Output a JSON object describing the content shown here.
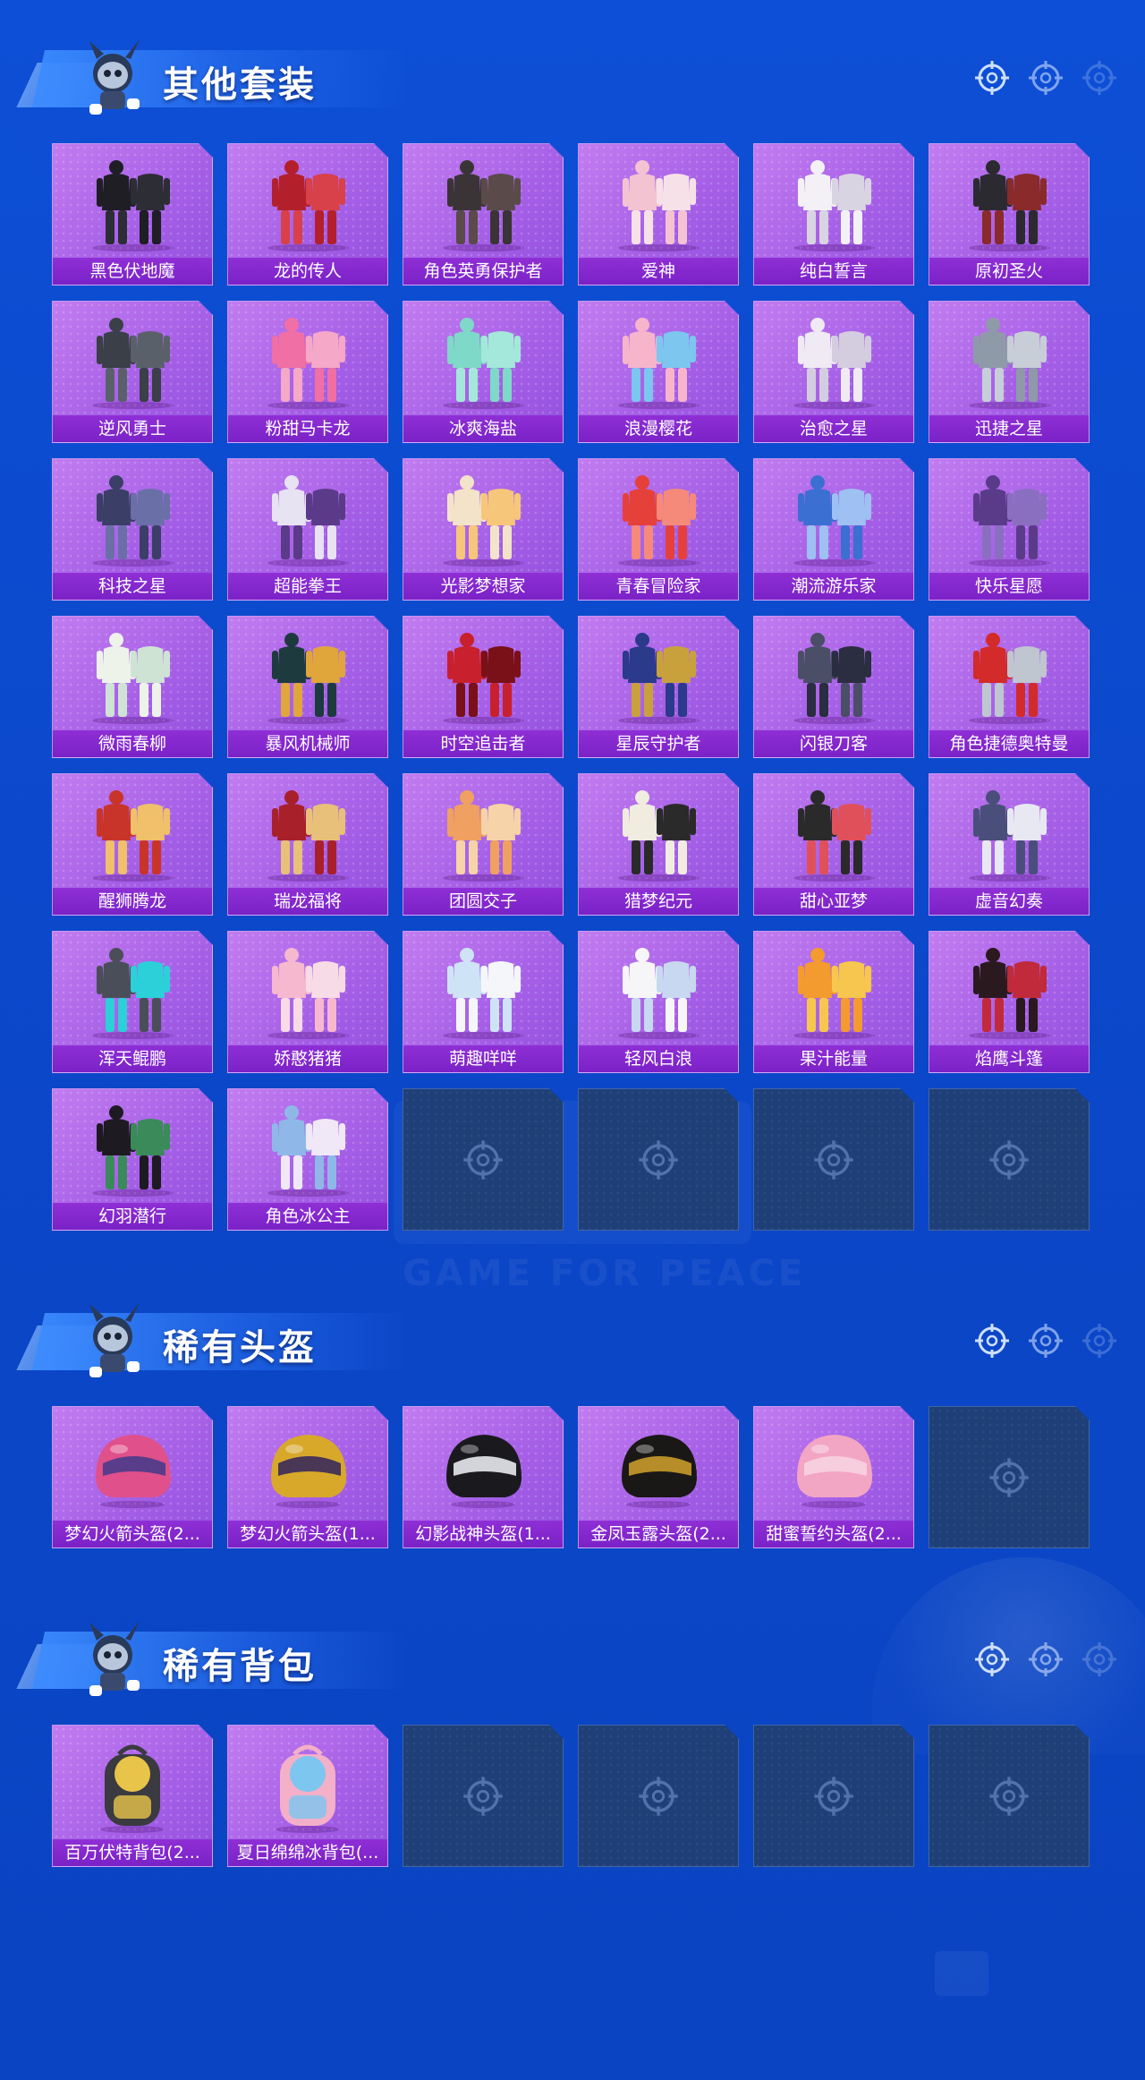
{
  "sections": [
    {
      "title": "其他套装",
      "items": [
        {
          "label": "黑色伏地魔",
          "icon": "hooded-outfit-icon"
        },
        {
          "label": "龙的传人",
          "icon": "red-robe-outfit-icon"
        },
        {
          "label": "角色英勇保护者",
          "icon": "armor-outfit-icon"
        },
        {
          "label": "爱神",
          "icon": "pink-dress-outfit-icon"
        },
        {
          "label": "纯白誓言",
          "icon": "white-wedding-outfit-icon"
        },
        {
          "label": "原初圣火",
          "icon": "dark-suit-outfit-icon"
        },
        {
          "label": "逆风勇士",
          "icon": "tactical-outfit-icon"
        },
        {
          "label": "粉甜马卡龙",
          "icon": "pink-coat-outfit-icon"
        },
        {
          "label": "冰爽海盐",
          "icon": "mint-outfit-icon"
        },
        {
          "label": "浪漫樱花",
          "icon": "sakura-outfit-icon"
        },
        {
          "label": "治愈之星",
          "icon": "white-outfit-icon"
        },
        {
          "label": "迅捷之星",
          "icon": "silver-outfit-icon"
        },
        {
          "label": "科技之星",
          "icon": "tech-outfit-icon"
        },
        {
          "label": "超能拳王",
          "icon": "boxer-outfit-icon"
        },
        {
          "label": "光影梦想家",
          "icon": "dreamer-outfit-icon"
        },
        {
          "label": "青春冒险家",
          "icon": "adventurer-outfit-icon"
        },
        {
          "label": "潮流游乐家",
          "icon": "street-outfit-icon"
        },
        {
          "label": "快乐星愿",
          "icon": "star-outfit-icon"
        },
        {
          "label": "微雨春柳",
          "icon": "willow-outfit-icon"
        },
        {
          "label": "暴风机械师",
          "icon": "mechanic-outfit-icon"
        },
        {
          "label": "时空追击者",
          "icon": "red-mech-outfit-icon"
        },
        {
          "label": "星辰守护者",
          "icon": "blue-hero-outfit-icon"
        },
        {
          "label": "闪银刀客",
          "icon": "blade-outfit-icon"
        },
        {
          "label": "角色捷德奥特曼",
          "icon": "ultraman-outfit-icon"
        },
        {
          "label": "醒狮腾龙",
          "icon": "lion-dance-outfit-icon"
        },
        {
          "label": "瑞龙福将",
          "icon": "dragon-general-outfit-icon"
        },
        {
          "label": "团圆交子",
          "icon": "festival-outfit-icon"
        },
        {
          "label": "猎梦纪元",
          "icon": "hunter-outfit-icon"
        },
        {
          "label": "甜心亚梦",
          "icon": "sweetheart-outfit-icon"
        },
        {
          "label": "虚音幻奏",
          "icon": "virtual-outfit-icon"
        },
        {
          "label": "浑天鲲鹏",
          "icon": "kunpeng-outfit-icon"
        },
        {
          "label": "娇憨猪猪",
          "icon": "piggy-outfit-icon"
        },
        {
          "label": "萌趣咩咩",
          "icon": "sheep-outfit-icon"
        },
        {
          "label": "轻风白浪",
          "icon": "breeze-outfit-icon"
        },
        {
          "label": "果汁能量",
          "icon": "orange-outfit-icon"
        },
        {
          "label": "焰鹰斗篷",
          "icon": "cloak-outfit-icon"
        },
        {
          "label": "幻羽潜行",
          "icon": "stealth-outfit-icon"
        },
        {
          "label": "角色冰公主",
          "icon": "ice-princess-outfit-icon"
        }
      ],
      "empty_slots": 4
    },
    {
      "title": "稀有头盔",
      "items": [
        {
          "label": "梦幻火箭头盔(2...",
          "icon": "pink-helmet-icon"
        },
        {
          "label": "梦幻火箭头盔(1...",
          "icon": "gold-helmet-icon"
        },
        {
          "label": "幻影战神头盔(1...",
          "icon": "black-helmet-icon"
        },
        {
          "label": "金凤玉露头盔(2...",
          "icon": "phoenix-helmet-icon"
        },
        {
          "label": "甜蜜誓约头盔(2...",
          "icon": "pink-bunny-helmet-icon"
        }
      ],
      "empty_slots": 1
    },
    {
      "title": "稀有背包",
      "items": [
        {
          "label": "百万伏特背包(2...",
          "icon": "cat-backpack-icon"
        },
        {
          "label": "夏日绵绵冰背包(...",
          "icon": "icecream-backpack-icon"
        }
      ],
      "empty_slots": 4
    }
  ],
  "watermark": "GAME FOR PEACE",
  "colors": {
    "card_bg": "#a45ee6",
    "label_bg": "#7a22c7",
    "empty_bg": "#1f3f78",
    "page_bg": "#0b47c9"
  }
}
